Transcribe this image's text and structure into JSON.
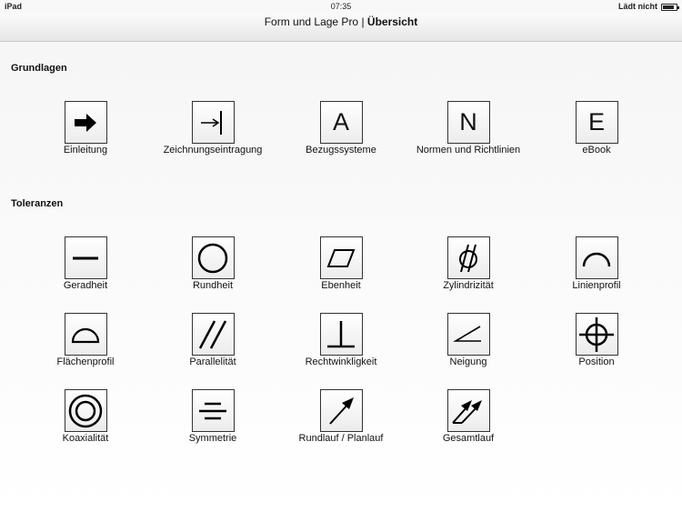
{
  "status_bar": {
    "device": "iPad",
    "time": "07:35",
    "charging": "Lädt nicht"
  },
  "nav": {
    "title_main": "Form und Lage Pro",
    "separator": " | ",
    "title_current": "Übersicht"
  },
  "sections": {
    "basics": {
      "title": "Grundlagen",
      "items": [
        {
          "label": "Einleitung",
          "icon": "arrow-right-icon"
        },
        {
          "label": "Zeichnungseintragung",
          "icon": "arrow-to-line-icon"
        },
        {
          "label": "Bezugssysteme",
          "icon": "letter-a-icon",
          "glyph": "A"
        },
        {
          "label": "Normen und Richtlinien",
          "icon": "letter-n-icon",
          "glyph": "N"
        },
        {
          "label": "eBook",
          "icon": "letter-e-icon",
          "glyph": "E"
        }
      ]
    },
    "tolerances": {
      "title": "Toleranzen",
      "items": [
        {
          "label": "Geradheit",
          "icon": "straightness-icon"
        },
        {
          "label": "Rundheit",
          "icon": "circularity-icon"
        },
        {
          "label": "Ebenheit",
          "icon": "flatness-icon"
        },
        {
          "label": "Zylindrizität",
          "icon": "cylindricity-icon"
        },
        {
          "label": "Linienprofil",
          "icon": "line-profile-icon"
        },
        {
          "label": "Flächenprofil",
          "icon": "surface-profile-icon"
        },
        {
          "label": "Parallelität",
          "icon": "parallelism-icon"
        },
        {
          "label": "Rechtwinkligkeit",
          "icon": "perpendicularity-icon"
        },
        {
          "label": "Neigung",
          "icon": "angularity-icon"
        },
        {
          "label": "Position",
          "icon": "position-icon"
        },
        {
          "label": "Koaxialität",
          "icon": "concentricity-icon"
        },
        {
          "label": "Symmetrie",
          "icon": "symmetry-icon"
        },
        {
          "label": "Rundlauf / Planlauf",
          "icon": "circular-runout-icon"
        },
        {
          "label": "Gesamtlauf",
          "icon": "total-runout-icon"
        }
      ]
    }
  }
}
